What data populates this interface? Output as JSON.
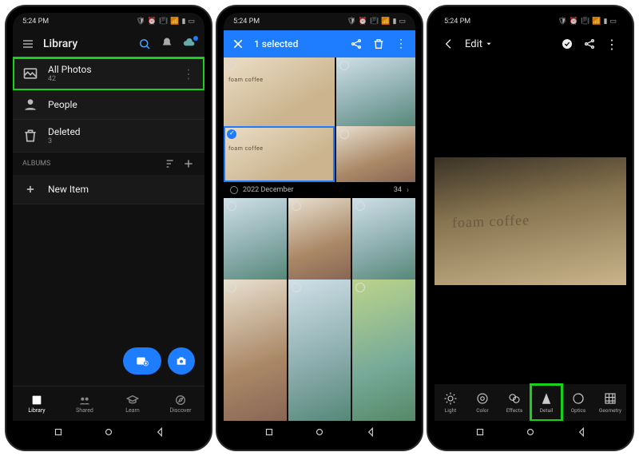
{
  "statusbar": {
    "time": "5:24 PM"
  },
  "phone1": {
    "header": {
      "title": "Library"
    },
    "rows": {
      "all_photos": {
        "label": "All Photos",
        "count": "42"
      },
      "people": {
        "label": "People"
      },
      "deleted": {
        "label": "Deleted",
        "count": "3"
      }
    },
    "albums_header": "ALBUMS",
    "new_item": "New Item",
    "nav": {
      "library": "Library",
      "shared": "Shared",
      "learn": "Learn",
      "discover": "Discover"
    }
  },
  "phone2": {
    "topbar": {
      "title": "1 selected"
    },
    "date_strip": {
      "label": "2022 December",
      "count": "34"
    }
  },
  "phone3": {
    "header": {
      "title": "Edit"
    },
    "image_text": "foam coffee",
    "tools": {
      "light": "Light",
      "color": "Color",
      "effects": "Effects",
      "detail": "Detail",
      "optics": "Optics",
      "geometry": "Geometry"
    }
  },
  "colors": {
    "accent": "#1e7cff",
    "highlight": "#17d317"
  }
}
